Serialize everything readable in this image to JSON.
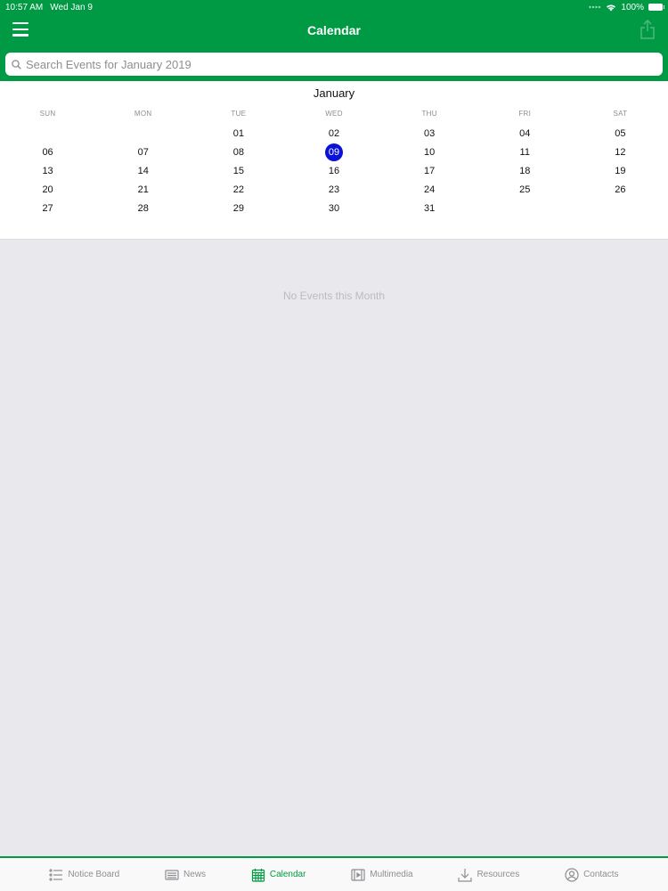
{
  "status_bar": {
    "time": "10:57 AM",
    "date": "Wed Jan 9",
    "battery": "100%"
  },
  "nav": {
    "title": "Calendar"
  },
  "search": {
    "placeholder": "Search Events for January 2019"
  },
  "calendar": {
    "month": "January",
    "weekdays": [
      "SUN",
      "MON",
      "TUE",
      "WED",
      "THU",
      "FRI",
      "SAT"
    ],
    "weeks": [
      [
        "",
        "",
        "01",
        "02",
        "03",
        "04",
        "05"
      ],
      [
        "06",
        "07",
        "08",
        "09",
        "10",
        "11",
        "12"
      ],
      [
        "13",
        "14",
        "15",
        "16",
        "17",
        "18",
        "19"
      ],
      [
        "20",
        "21",
        "22",
        "23",
        "24",
        "25",
        "26"
      ],
      [
        "27",
        "28",
        "29",
        "30",
        "31",
        "",
        ""
      ]
    ],
    "selected_day": "09",
    "selected_color": "#0a11d8"
  },
  "empty_message": "No Events this Month",
  "tabs": [
    {
      "label": "Notice Board",
      "icon": "list-icon",
      "active": false
    },
    {
      "label": "News",
      "icon": "newspaper-icon",
      "active": false
    },
    {
      "label": "Calendar",
      "icon": "calendar-icon",
      "active": true
    },
    {
      "label": "Multimedia",
      "icon": "film-icon",
      "active": false
    },
    {
      "label": "Resources",
      "icon": "download-icon",
      "active": false
    },
    {
      "label": "Contacts",
      "icon": "contact-icon",
      "active": false
    }
  ],
  "colors": {
    "brand_green": "#009a44",
    "background": "#e9e8ec"
  }
}
